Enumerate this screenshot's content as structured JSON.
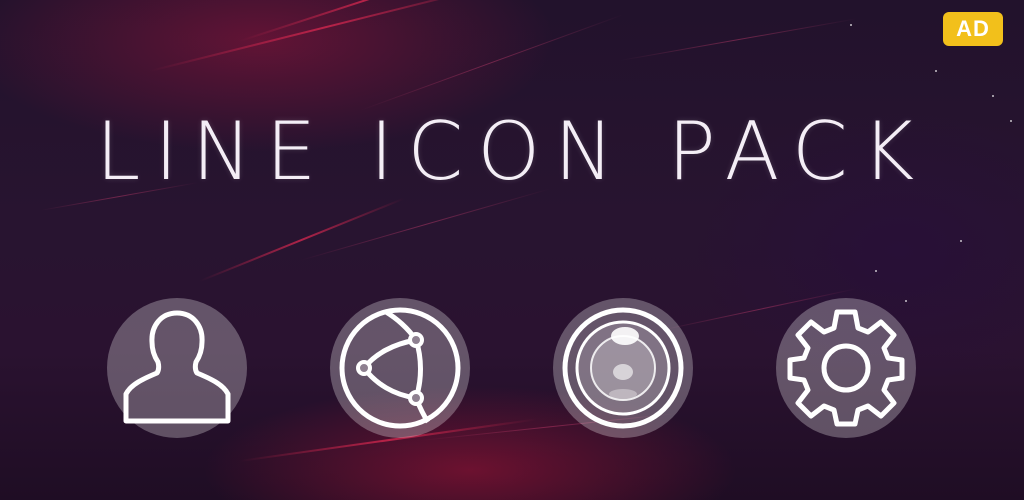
{
  "title": "LINE ICON PACK",
  "ad_badge": "AD",
  "colors": {
    "badge": "#f2c01b",
    "background": "#24122c",
    "accent": "#dc2850",
    "icon_stroke": "#ffffff"
  },
  "icons": [
    {
      "name": "user-icon"
    },
    {
      "name": "browser-globe-icon"
    },
    {
      "name": "camera-icon"
    },
    {
      "name": "settings-gear-icon"
    }
  ]
}
